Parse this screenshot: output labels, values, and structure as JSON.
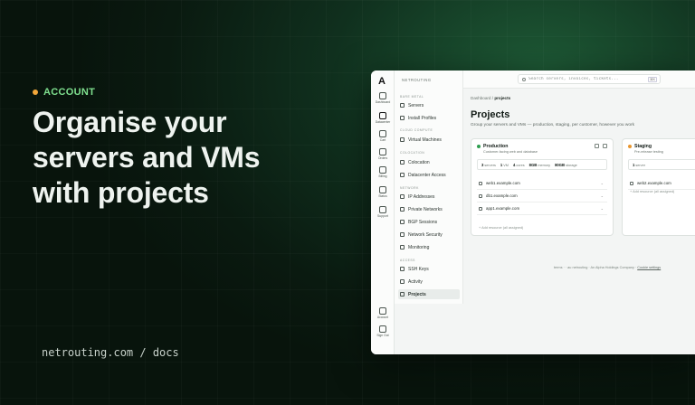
{
  "hero": {
    "eyebrow": "ACCOUNT",
    "headline_lines": [
      "Organise your",
      "servers and VMs",
      "with projects"
    ],
    "footer_url": "netrouting.com / docs"
  },
  "colors": {
    "accent": "#7fe08f",
    "dot": "#f2a73a",
    "production": "#2e9e4f",
    "staging": "#e8962f"
  },
  "app": {
    "brand": "NETROUTING",
    "rail": [
      {
        "label": "Dashboard",
        "icon": "home-icon"
      },
      {
        "label": "Datacenter",
        "icon": "server-icon"
      },
      {
        "label": "Cart",
        "icon": "cart-icon"
      },
      {
        "label": "Orders",
        "icon": "box-icon"
      },
      {
        "label": "Billing",
        "icon": "card-icon"
      },
      {
        "label": "Status",
        "icon": "pulse-icon"
      },
      {
        "label": "Support",
        "icon": "support-icon"
      },
      {
        "label": "Account",
        "icon": "user-icon"
      },
      {
        "label": "Sign Out",
        "icon": "logout-icon"
      }
    ],
    "nav": {
      "sections": [
        "BARE METAL",
        "CLOUD COMPUTE",
        "COLOCATION",
        "NETWORK",
        "ACCESS"
      ],
      "items": {
        "servers": "Servers",
        "install_profiles": "Install Profiles",
        "virtual_machines": "Virtual Machines",
        "colocation": "Colocation",
        "datacenter_access": "Datacenter Access",
        "ip_addresses": "IP Addresses",
        "private_networks": "Private Networks",
        "bgp_sessions": "BGP Sessions",
        "network_security": "Network Security",
        "monitoring": "Monitoring",
        "ssh_keys": "SSH Keys",
        "activity": "Activity",
        "projects": "Projects"
      }
    },
    "search": {
      "placeholder": "Search servers, invoices, tickets...",
      "shortcut": "⌘K"
    },
    "breadcrumb": {
      "root": "Dashboard",
      "sep": "/",
      "current": "projects"
    },
    "title": "Projects",
    "subtitle": "Group your servers and VMs — production, staging, per customer, however you work",
    "projects": [
      {
        "name": "Production",
        "desc": "Customer-facing web and database",
        "stats": [
          {
            "v": "3",
            "l": "servers"
          },
          {
            "v": "1",
            "l": "VM"
          },
          {
            "v": "4",
            "l": "cores"
          },
          {
            "v": "8GB",
            "l": "memory"
          },
          {
            "v": "80GB",
            "l": "storage"
          }
        ],
        "resources": [
          "web1.example.com",
          "db1.example.com",
          "app1.example.com"
        ],
        "add": "+ Add resource (all assigned)"
      },
      {
        "name": "Staging",
        "desc": "Pre-release testing",
        "stats": [
          {
            "v": "1",
            "l": "server"
          }
        ],
        "resources": [
          "web2.example.com"
        ],
        "add": "+ Add resource (all assigned)"
      }
    ],
    "footer": {
      "text": "terms · · au netrouting · An Alpha Holdings Company ·",
      "link": "Cookie settings"
    }
  }
}
